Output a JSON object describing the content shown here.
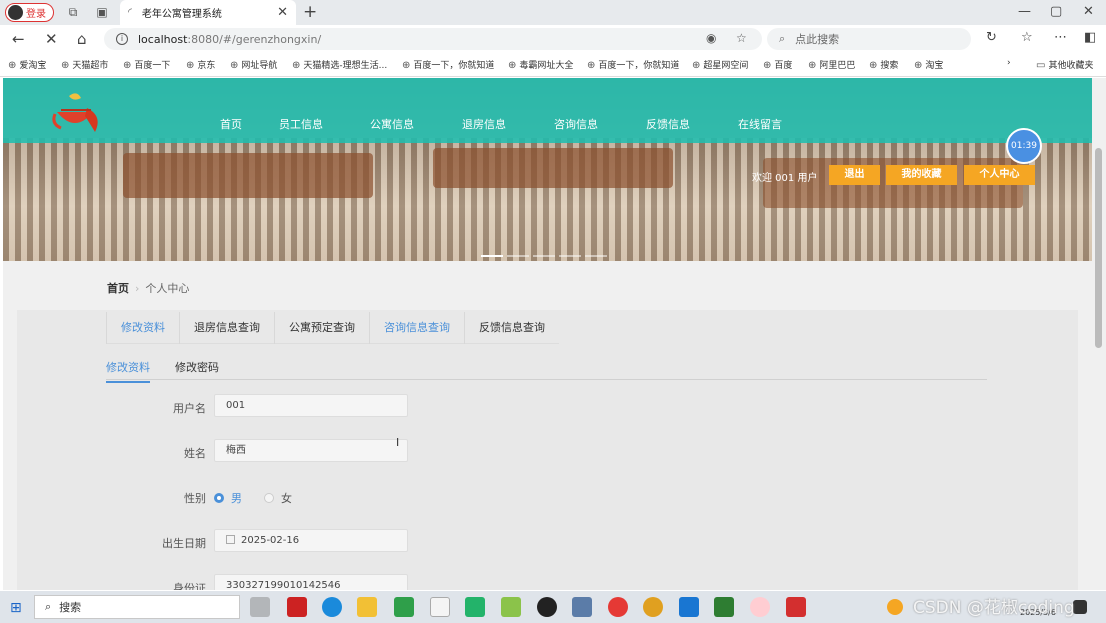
{
  "browser": {
    "login_label": "登录",
    "tab_title": "老年公寓管理系统",
    "url_host": "localhost",
    "url_path": ":8080/#/gerenzhongxin/",
    "search_placeholder": "点此搜索"
  },
  "bookmarks": [
    "爱淘宝",
    "天猫超市",
    "百度一下",
    "京东",
    "网址导航",
    "天猫精选-理想生活...",
    "百度一下，你就知道",
    "毒霸网址大全",
    "百度一下，你就知道",
    "超星网空间",
    "百度",
    "阿里巴巴",
    "搜索",
    "淘宝"
  ],
  "bookmarks_other": "其他收藏夹",
  "site": {
    "nav": [
      "首页",
      "员工信息",
      "公寓信息",
      "退房信息",
      "咨询信息",
      "反馈信息",
      "在线留言"
    ],
    "clock": "01:39",
    "welcome": "欢迎 001 用户",
    "btn_logout": "退出",
    "btn_favorites": "我的收藏",
    "btn_profile": "个人中心"
  },
  "breadcrumb": {
    "home": "首页",
    "current": "个人中心"
  },
  "tabs": [
    "修改资料",
    "退房信息查询",
    "公寓预定查询",
    "咨询信息查询",
    "反馈信息查询"
  ],
  "subtabs": {
    "edit": "修改资料",
    "password": "修改密码"
  },
  "form": {
    "username_label": "用户名",
    "username": "001",
    "name_label": "姓名",
    "name": "梅西",
    "gender_label": "性别",
    "gender_male": "男",
    "gender_female": "女",
    "birth_label": "出生日期",
    "birth": "2025-02-16",
    "idcard_label": "身份证",
    "idcard": "330327199010142546"
  },
  "taskbar": {
    "search": "搜索",
    "date": "2025/3/6"
  },
  "watermark": "CSDN @花椒coding"
}
